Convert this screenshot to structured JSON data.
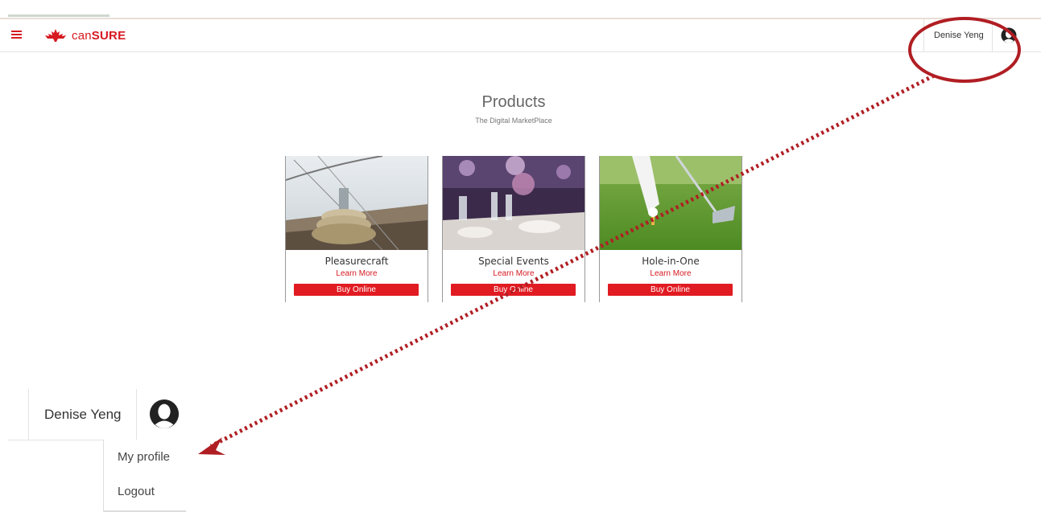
{
  "header": {
    "logo_prefix": "can",
    "logo_suffix": "SURE",
    "user_name": "Denise Yeng"
  },
  "page": {
    "title": "Products",
    "subtitle": "The Digital MarketPlace"
  },
  "products": [
    {
      "name": "Pleasurecraft",
      "learn_more": "Learn More",
      "buy": "Buy Online"
    },
    {
      "name": "Special Events",
      "learn_more": "Learn More",
      "buy": "Buy Online"
    },
    {
      "name": "Hole-in-One",
      "learn_more": "Learn More",
      "buy": "Buy Online"
    }
  ],
  "zoom": {
    "user_name": "Denise Yeng",
    "menu": [
      {
        "label": "My profile"
      },
      {
        "label": "Logout"
      }
    ]
  },
  "colors": {
    "brand_red": "#d71920",
    "button_red": "#e11b22",
    "annotation_red": "#b01e23"
  },
  "icons": {
    "menu": "hamburger-icon",
    "logo": "maple-leaf-icon",
    "avatar": "user-avatar-icon"
  }
}
